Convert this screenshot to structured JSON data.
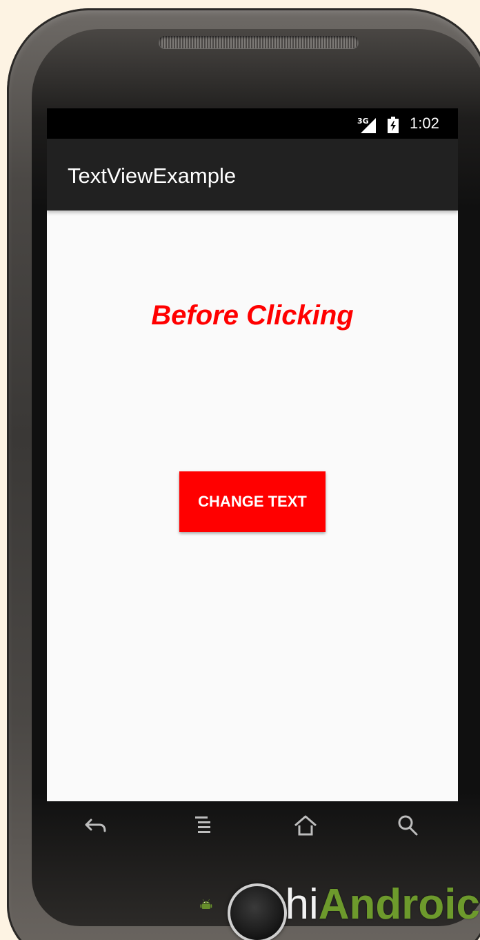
{
  "status_bar": {
    "network": "3G",
    "time": "1:02"
  },
  "app_bar": {
    "title": "TextViewExample"
  },
  "content": {
    "message": "Before Clicking",
    "button_label": "CHANGE TEXT"
  },
  "navigation": {
    "back_icon": "back-icon",
    "menu_icon": "menu-icon",
    "home_icon": "home-icon",
    "search_icon": "search-icon"
  },
  "watermark": {
    "text_part1": "Abhi",
    "text_part2": "Androic"
  },
  "colors": {
    "accent": "#ff0000",
    "app_bar": "#212121",
    "screen_bg": "#fafafa"
  }
}
